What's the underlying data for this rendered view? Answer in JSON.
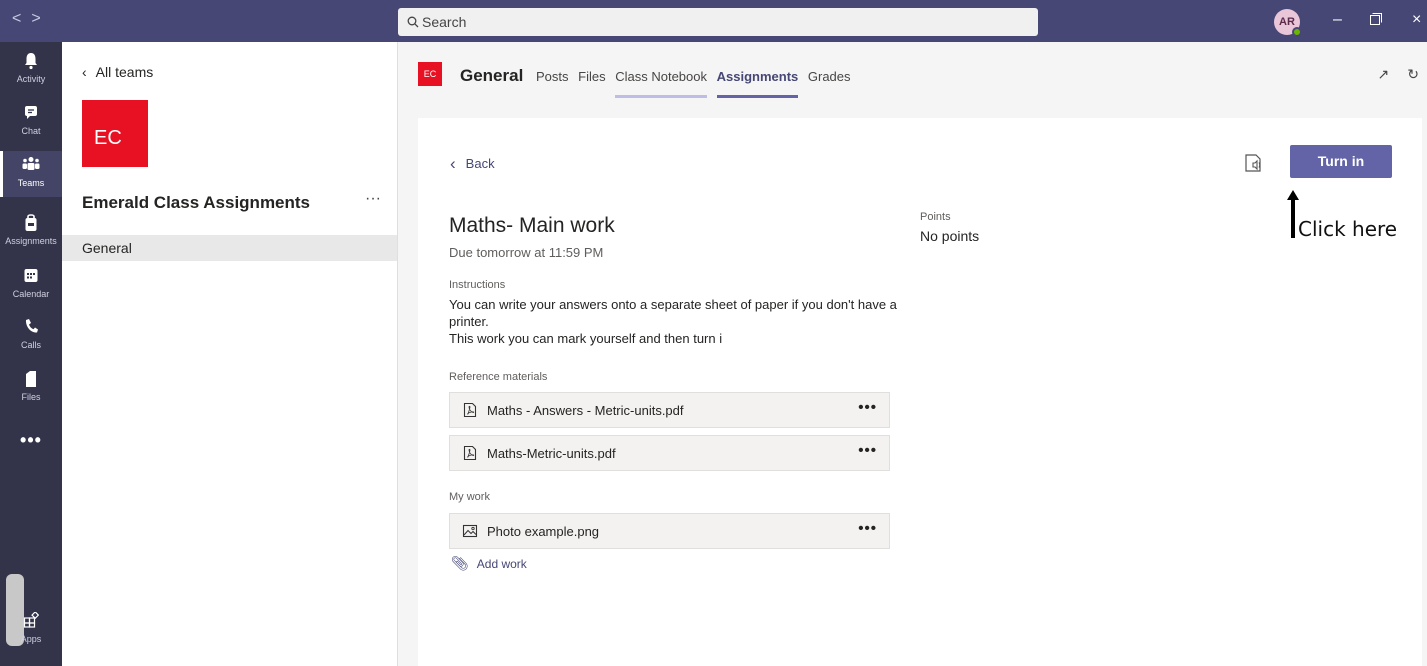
{
  "titlebar": {
    "back_label": "<",
    "forward_label": ">",
    "search_placeholder": "Search",
    "avatar_initials": "AR",
    "presence_color": "#6bb700"
  },
  "rail": {
    "items": [
      {
        "label": "Activity",
        "icon": "bell-icon"
      },
      {
        "label": "Chat",
        "icon": "chat-icon"
      },
      {
        "label": "Teams",
        "icon": "teams-icon",
        "active": true
      },
      {
        "label": "Assignments",
        "icon": "assignments-icon"
      },
      {
        "label": "Calendar",
        "icon": "calendar-icon"
      },
      {
        "label": "Calls",
        "icon": "phone-icon"
      },
      {
        "label": "Files",
        "icon": "file-icon"
      },
      {
        "label": "",
        "icon": "more-icon"
      },
      {
        "label": "Apps",
        "icon": "apps-icon"
      }
    ]
  },
  "teampanel": {
    "all_teams": "All teams",
    "tile": "EC",
    "team_name": "Emerald Class Assignments",
    "more": "···",
    "channel": "General"
  },
  "header": {
    "channel_tile": "EC",
    "channel_name": "General",
    "tabs": [
      "Posts",
      "Files",
      "Class Notebook",
      "Assignments",
      "Grades"
    ],
    "active_tab": "Assignments"
  },
  "assignment": {
    "back": "Back",
    "turn_in": "Turn in",
    "title": "Maths- Main work",
    "due": "Due tomorrow at 11:59 PM",
    "points_label": "Points",
    "points_value": "No points",
    "instructions_label": "Instructions",
    "instructions_line1": "You can write your answers onto a separate sheet of paper if you don't have a printer.",
    "instructions_line2": "This work you can mark yourself and then turn i",
    "reference_label": "Reference materials",
    "reference_files": [
      "Maths - Answers - Metric-units.pdf",
      "Maths-Metric-units.pdf"
    ],
    "my_work_label": "My work",
    "my_work_files": [
      "Photo example.png"
    ],
    "file_more": "•••",
    "add_work": "Add work"
  },
  "annotation": {
    "text": "Click here"
  },
  "colors": {
    "titlebar": "#464775",
    "rail": "#33344a",
    "accent": "#6264a7",
    "team_tile": "#e81123"
  }
}
